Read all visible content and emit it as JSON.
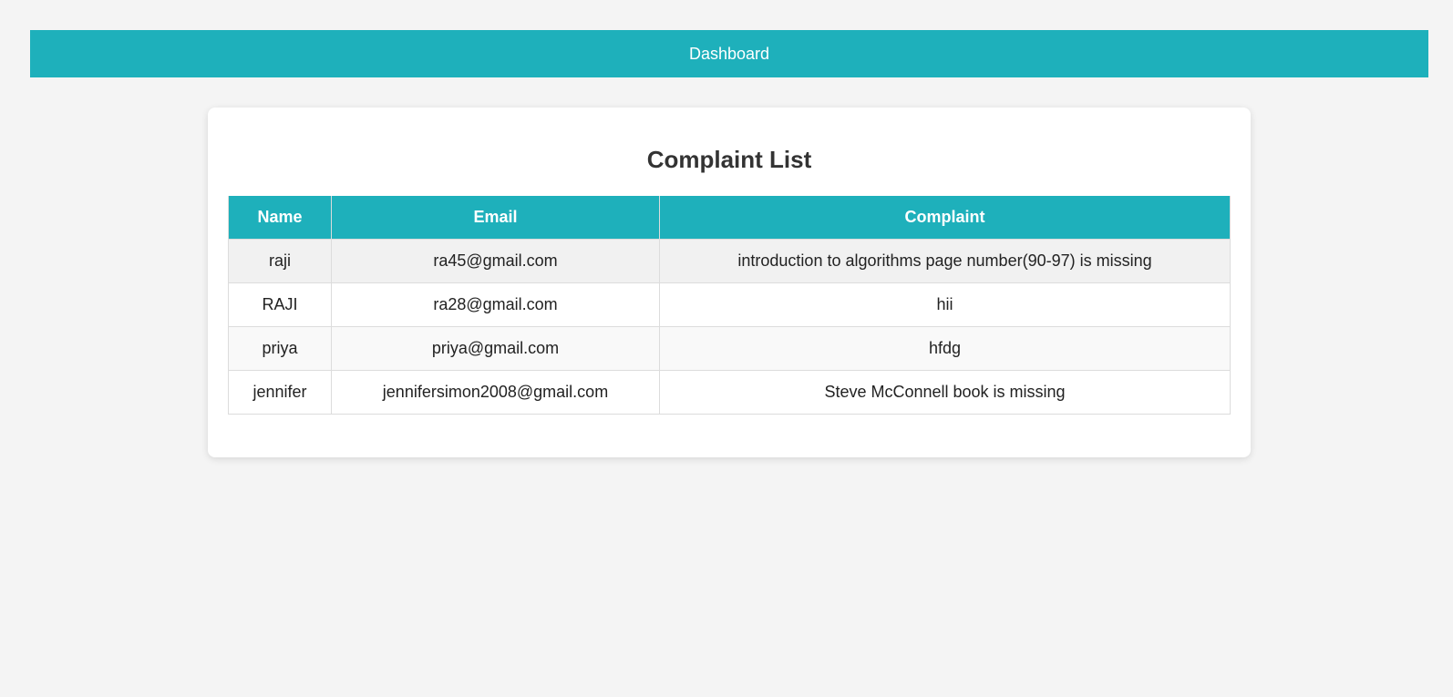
{
  "nav": {
    "dashboard_label": "Dashboard"
  },
  "card": {
    "title": "Complaint List"
  },
  "table": {
    "headers": [
      "Name",
      "Email",
      "Complaint"
    ],
    "rows": [
      {
        "name": "raji",
        "email": "ra45@gmail.com",
        "complaint": "introduction to algorithms page number(90-97) is missing"
      },
      {
        "name": "RAJI",
        "email": "ra28@gmail.com",
        "complaint": "hii"
      },
      {
        "name": "priya",
        "email": "priya@gmail.com",
        "complaint": "hfdg"
      },
      {
        "name": "jennifer",
        "email": "jennifersimon2008@gmail.com",
        "complaint": "Steve McConnell book is missing"
      }
    ]
  },
  "colors": {
    "accent": "#1eb0bb",
    "background": "#f4f4f4"
  }
}
